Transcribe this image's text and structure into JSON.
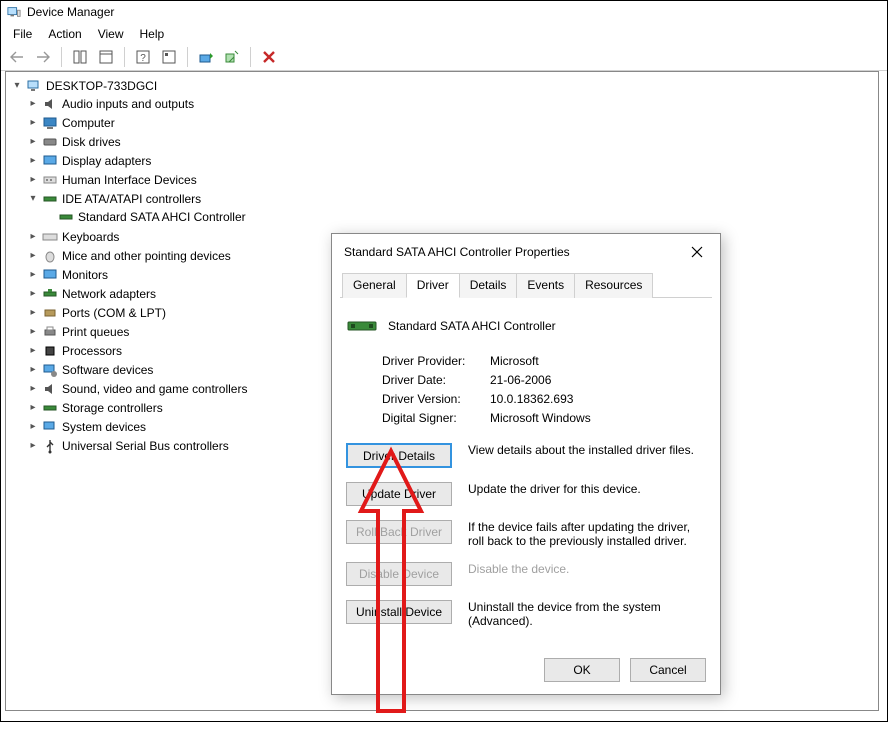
{
  "window": {
    "title": "Device Manager"
  },
  "menu": {
    "file": "File",
    "action": "Action",
    "view": "View",
    "help": "Help"
  },
  "tree": {
    "root": "DESKTOP-733DGCI",
    "items": [
      "Audio inputs and outputs",
      "Computer",
      "Disk drives",
      "Display adapters",
      "Human Interface Devices",
      "IDE ATA/ATAPI controllers",
      "Keyboards",
      "Mice and other pointing devices",
      "Monitors",
      "Network adapters",
      "Ports (COM & LPT)",
      "Print queues",
      "Processors",
      "Software devices",
      "Sound, video and game controllers",
      "Storage controllers",
      "System devices",
      "Universal Serial Bus controllers"
    ],
    "child_ide": "Standard SATA AHCI Controller"
  },
  "dialog": {
    "title": "Standard SATA AHCI Controller Properties",
    "tabs": {
      "general": "General",
      "driver": "Driver",
      "details": "Details",
      "events": "Events",
      "resources": "Resources"
    },
    "device_name": "Standard SATA AHCI Controller",
    "props": {
      "provider_label": "Driver Provider:",
      "provider_value": "Microsoft",
      "date_label": "Driver Date:",
      "date_value": "21-06-2006",
      "version_label": "Driver Version:",
      "version_value": "10.0.18362.693",
      "signer_label": "Digital Signer:",
      "signer_value": "Microsoft Windows"
    },
    "buttons": {
      "details": "Driver Details",
      "details_desc": "View details about the installed driver files.",
      "update": "Update Driver",
      "update_desc": "Update the driver for this device.",
      "rollback": "Roll Back Driver",
      "rollback_desc": "If the device fails after updating the driver, roll back to the previously installed driver.",
      "disable": "Disable Device",
      "disable_desc": "Disable the device.",
      "uninstall": "Uninstall Device",
      "uninstall_desc": "Uninstall the device from the system (Advanced).",
      "ok": "OK",
      "cancel": "Cancel"
    }
  }
}
